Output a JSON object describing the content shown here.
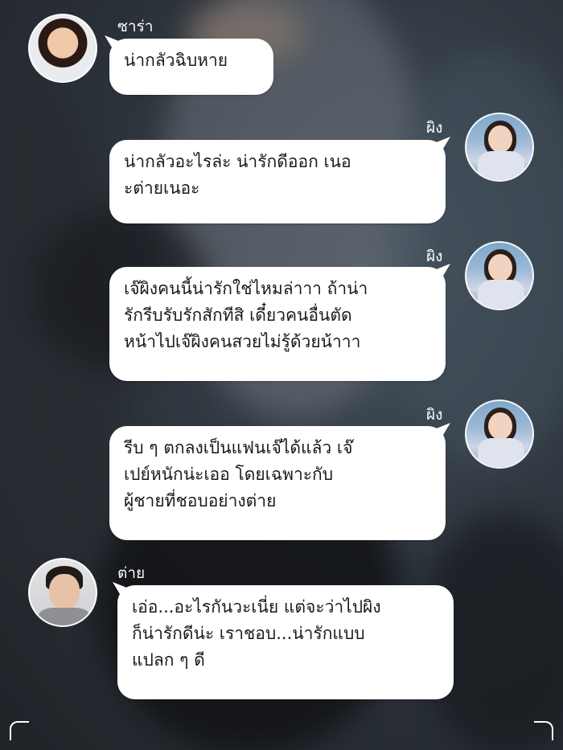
{
  "messages": [
    {
      "sender": "ซาร่า",
      "side": "left",
      "text": "น่ากลัวฉิบหาย"
    },
    {
      "sender": "ผิง",
      "side": "right",
      "text": "น่ากลัวอะไรล่ะ น่ารักดีออก เนอ\nะต่ายเนอะ"
    },
    {
      "sender": "ผิง",
      "side": "right",
      "text": "เจ๊ผิงคนนี้น่ารักใช่ไหมล่าาา ถ้าน่า\nรักรีบรับรักสักทีสิ เดี๋ยวคนอื่นตัด\nหน้าไปเจ๊ผิงคนสวยไม่รู้ด้วยน้าาา"
    },
    {
      "sender": "ผิง",
      "side": "right",
      "text": "รีบ ๆ ตกลงเป็นแฟนเจ๊ได้แล้ว เจ๊\nเปย์หนักน่ะเออ โดยเฉพาะกับ\nผู้ชายที่ชอบอย่างต่าย"
    },
    {
      "sender": "ต่าย",
      "side": "left",
      "text": "เอ่อ...อะไรกันวะเนี่ย แต่จะว่าไปผิง\nก็น่ารักดีน่ะ เราชอบ...น่ารักแบบ\nแปลก ๆ ดี"
    }
  ],
  "colors": {
    "bubble": "#ffffff",
    "text": "#1a1a1a",
    "name": "#ffffff"
  }
}
